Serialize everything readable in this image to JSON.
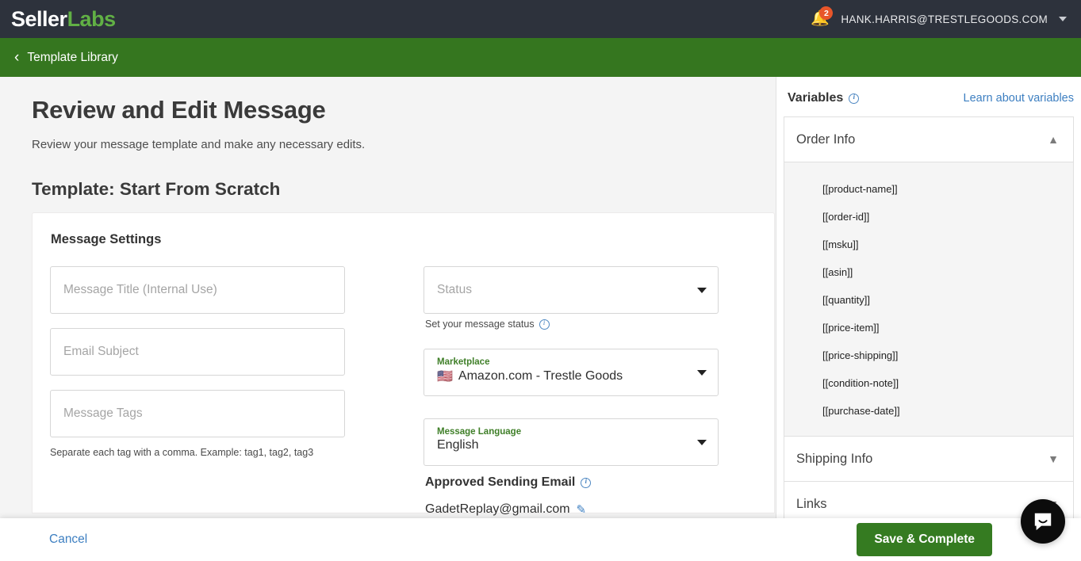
{
  "topnav": {
    "logo_first": "Seller",
    "logo_second": "Labs",
    "bell_icon": "bell-icon",
    "notification_count": "2",
    "user_email": "HANK.HARRIS@TRESTLEGOODS.COM",
    "caret_icon": "chevron-down-icon"
  },
  "subbar": {
    "back_icon": "chevron-left-icon",
    "label": "Template Library",
    "bg_color": "#35761f"
  },
  "main": {
    "page_title": "Review and Edit Message",
    "page_subtitle": "Review your message template and make any necessary edits.",
    "template_title": "Template: Start From Scratch",
    "card_title": "Message Settings",
    "fields": {
      "message_title_placeholder": "Message Title (Internal Use)",
      "message_title_value": "",
      "email_subject_placeholder": "Email Subject",
      "email_subject_value": "",
      "message_tags_placeholder": "Message Tags",
      "message_tags_value": "",
      "tags_helper": "Separate each tag with a comma. Example: tag1, tag2, tag3"
    },
    "status": {
      "placeholder": "Status",
      "value": "",
      "note": "Set your message status",
      "info_icon": "info-icon"
    },
    "marketplace": {
      "label": "Marketplace",
      "value": "Amazon.com - Trestle Goods",
      "flag_icon": "us-flag-icon"
    },
    "language": {
      "label": "Message Language",
      "value": "English"
    },
    "approved_email": {
      "title": "Approved Sending Email",
      "info_icon": "info-icon",
      "value": "GadetReplay@gmail.com",
      "edit_icon": "pencil-icon"
    }
  },
  "variables": {
    "title": "Variables",
    "info_icon": "info-icon",
    "learn_link": "Learn about variables",
    "sections": [
      {
        "label": "Order Info",
        "expanded": true,
        "chevron": "chevron-up-icon",
        "items": [
          "[[product-name]]",
          "[[order-id]]",
          "[[msku]]",
          "[[asin]]",
          "[[quantity]]",
          "[[price-item]]",
          "[[price-shipping]]",
          "[[condition-note]]",
          "[[purchase-date]]"
        ]
      },
      {
        "label": "Shipping Info",
        "expanded": false,
        "chevron": "chevron-down-icon",
        "items": []
      },
      {
        "label": "Links",
        "expanded": false,
        "chevron": "chevron-down-icon",
        "items": []
      }
    ]
  },
  "footer": {
    "cancel_label": "Cancel",
    "save_label": "Save & Complete",
    "save_color": "#357b21"
  },
  "chat_widget": {
    "icon": "intercom-chat-icon"
  }
}
